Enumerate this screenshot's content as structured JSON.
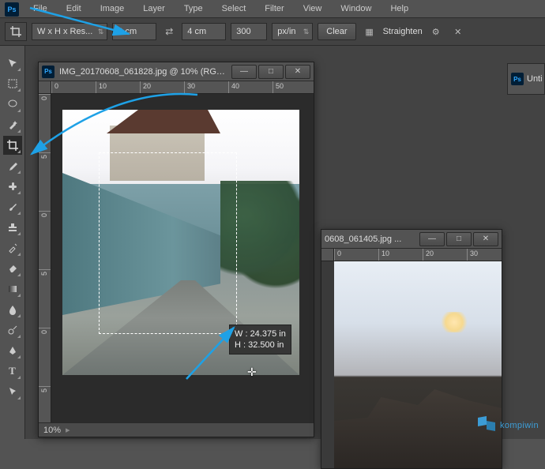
{
  "menu": {
    "items": [
      "File",
      "Edit",
      "Image",
      "Layer",
      "Type",
      "Select",
      "Filter",
      "View",
      "Window",
      "Help"
    ]
  },
  "options": {
    "preset": "W x H x Res...",
    "width": "3 cm",
    "height": "4 cm",
    "resolution": "300",
    "unit": "px/in",
    "clear": "Clear",
    "straighten": "Straighten"
  },
  "doc1": {
    "title": "IMG_20170608_061828.jpg @ 10% (RGB...",
    "zoom": "10%",
    "ruler_h": [
      "0",
      "10",
      "20",
      "30",
      "40",
      "50"
    ],
    "ruler_v": [
      "0",
      "5",
      "0",
      "5",
      "0",
      "5"
    ],
    "readout": {
      "w_label": "W :",
      "w_val": "24.375 in",
      "h_label": "H :",
      "h_val": "32.500 in"
    }
  },
  "doc2": {
    "title": "0608_061405.jpg ...",
    "ruler_h": [
      "0",
      "10",
      "20",
      "30"
    ]
  },
  "panel_right": {
    "title": "Unti"
  },
  "arrow_label_1": "",
  "watermark": "kompiwin",
  "icons": {
    "crop": "crop-icon",
    "move": "move-icon",
    "marquee": "marquee-icon",
    "lasso": "lasso-icon",
    "wand": "wand-icon",
    "eyedropper": "eyedropper-icon",
    "heal": "heal-icon",
    "brush": "brush-icon",
    "stamp": "stamp-icon",
    "history": "history-brush-icon",
    "eraser": "eraser-icon",
    "gradient": "gradient-icon",
    "blur": "blur-icon",
    "dodge": "dodge-icon",
    "pen": "pen-icon",
    "type": "type-icon",
    "path": "path-select-icon"
  }
}
